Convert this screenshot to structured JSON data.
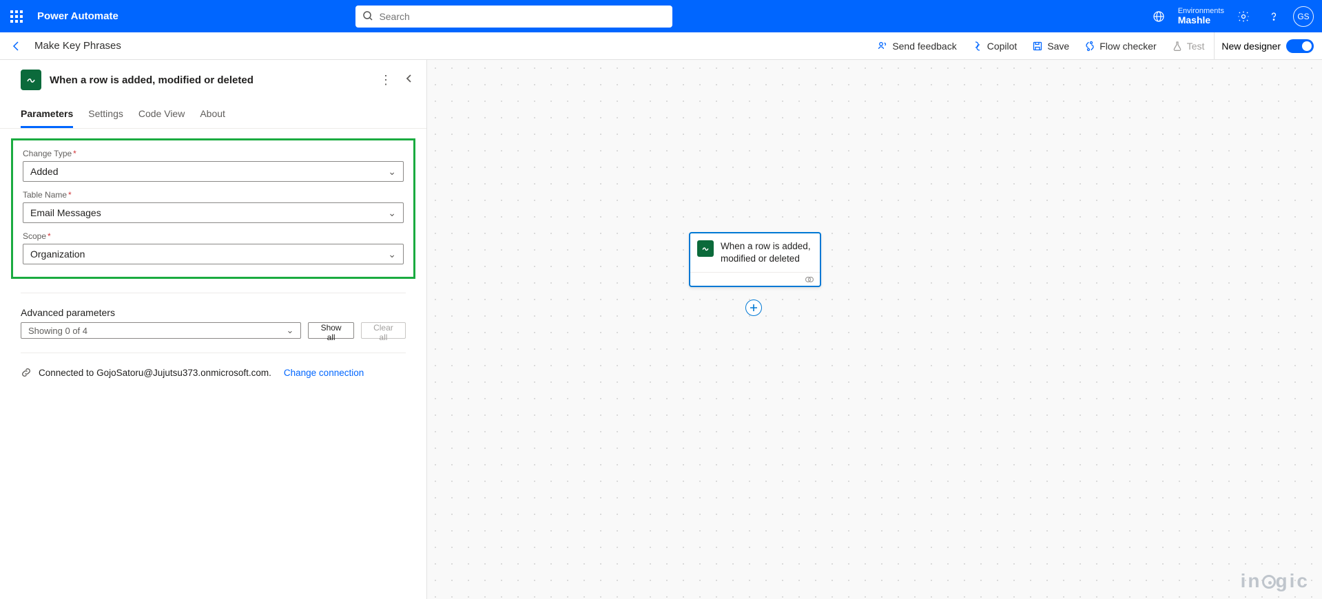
{
  "header": {
    "app_title": "Power Automate",
    "search_placeholder": "Search",
    "env_label": "Environments",
    "env_name": "Mashle",
    "avatar_initials": "GS"
  },
  "toolbar": {
    "flow_name": "Make Key Phrases",
    "send_feedback": "Send feedback",
    "copilot": "Copilot",
    "save": "Save",
    "flow_checker": "Flow checker",
    "test": "Test",
    "new_designer": "New designer"
  },
  "panel": {
    "trigger_title": "When a row is added, modified or deleted",
    "tabs": {
      "parameters": "Parameters",
      "settings": "Settings",
      "code_view": "Code View",
      "about": "About"
    },
    "fields": {
      "change_type": {
        "label": "Change Type",
        "value": "Added"
      },
      "table_name": {
        "label": "Table Name",
        "value": "Email Messages"
      },
      "scope": {
        "label": "Scope",
        "value": "Organization"
      }
    },
    "advanced": {
      "label": "Advanced parameters",
      "showing": "Showing 0 of 4",
      "show_all": "Show all",
      "clear_all": "Clear all"
    },
    "connection": {
      "prefix": "Connected to ",
      "account": "GojoSatoru@Jujutsu373.onmicrosoft.com.",
      "change": "Change connection"
    }
  },
  "canvas": {
    "node_title": "When a row is added, modified or deleted"
  },
  "watermark": "inogic"
}
